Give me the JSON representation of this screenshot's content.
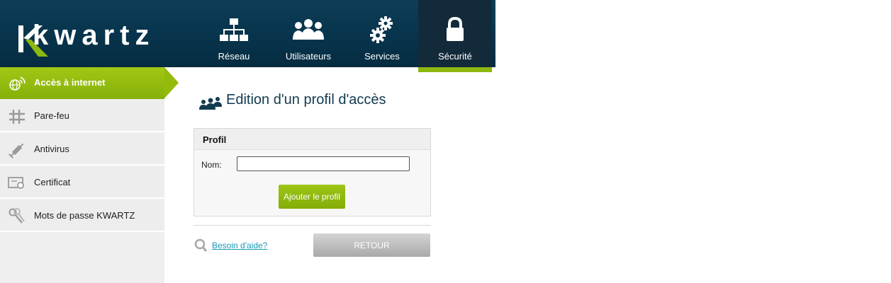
{
  "header": {
    "logo_text": "KWARTZ",
    "nav": [
      {
        "label": "Réseau",
        "icon": "network-icon"
      },
      {
        "label": "Utilisateurs",
        "icon": "users-icon"
      },
      {
        "label": "Services",
        "icon": "gears-icon"
      },
      {
        "label": "Sécurité",
        "icon": "lock-icon",
        "active": true
      }
    ]
  },
  "sidebar": {
    "items": [
      {
        "label": "Accès à internet",
        "icon": "globe-wifi-icon",
        "active": true
      },
      {
        "label": "Pare-feu",
        "icon": "firewall-grid-icon"
      },
      {
        "label": "Antivirus",
        "icon": "syringe-icon"
      },
      {
        "label": "Certificat",
        "icon": "certificate-icon"
      },
      {
        "label": "Mots de passe KWARTZ",
        "icon": "keys-icon"
      }
    ]
  },
  "main": {
    "title": "Edition d'un profil d'accès",
    "panel": {
      "heading": "Profil",
      "name_label": "Nom:",
      "name_value": "",
      "add_button": "Ajouter le profil"
    },
    "help_link": "Besoin d'aide?",
    "back_button": "RETOUR"
  },
  "colors": {
    "header_bg": "#07344c",
    "accent_green": "#8cb80f",
    "title_color": "#123a50",
    "link_color": "#1a9bb4"
  }
}
